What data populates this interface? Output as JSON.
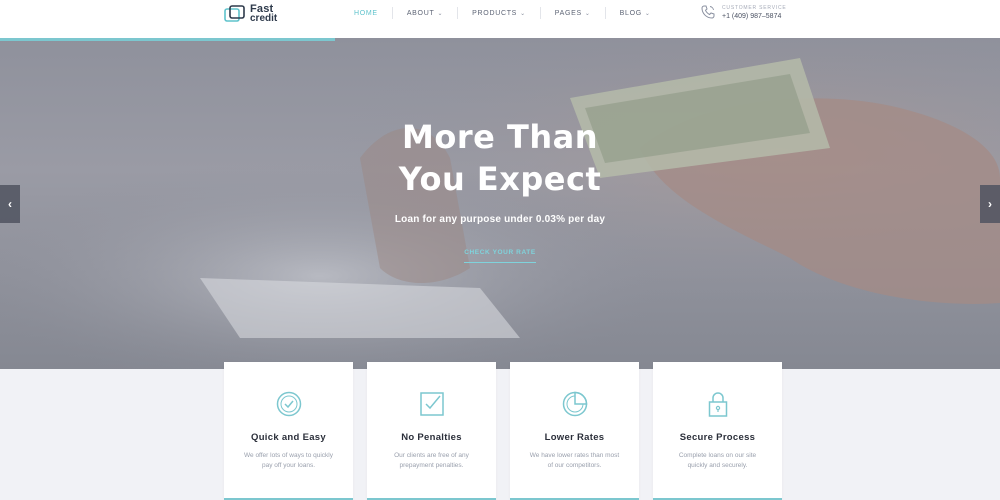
{
  "brand": {
    "line1": "Fast",
    "line2": "credit"
  },
  "nav": [
    {
      "label": "HOME",
      "active": true,
      "dropdown": false
    },
    {
      "label": "ABOUT",
      "active": false,
      "dropdown": true
    },
    {
      "label": "PRODUCTS",
      "active": false,
      "dropdown": true
    },
    {
      "label": "PAGES",
      "active": false,
      "dropdown": true
    },
    {
      "label": "BLOG",
      "active": false,
      "dropdown": true
    }
  ],
  "contact": {
    "label": "CUSTOMER SERVICE",
    "phone": "+1 (409) 987–5874",
    "icon": "phone-icon"
  },
  "hero": {
    "title_line1": "More Than",
    "title_line2": "You Expect",
    "subtitle": "Loan for any purpose under 0.03% per day",
    "cta": "CHECK YOUR RATE",
    "prev_icon": "chevron-left-icon",
    "next_icon": "chevron-right-icon"
  },
  "features": [
    {
      "title": "Quick and Easy",
      "description": "We offer lots of ways to quickly pay off your loans.",
      "icon": "clock-check-icon"
    },
    {
      "title": "No Penalties",
      "description": "Our clients are free of any prepayment penalties.",
      "icon": "checkbox-icon"
    },
    {
      "title": "Lower Rates",
      "description": "We have lower rates than most of our competitors.",
      "icon": "pie-chart-icon"
    },
    {
      "title": "Secure Process",
      "description": "Complete loans on our site quickly and securely.",
      "icon": "lock-icon"
    }
  ],
  "colors": {
    "accent": "#7cc7cf",
    "active_nav": "#5fc3cc",
    "dark_text": "#2b2f3a",
    "muted_text": "#9aa0ad",
    "page_bg": "#f1f2f6"
  }
}
